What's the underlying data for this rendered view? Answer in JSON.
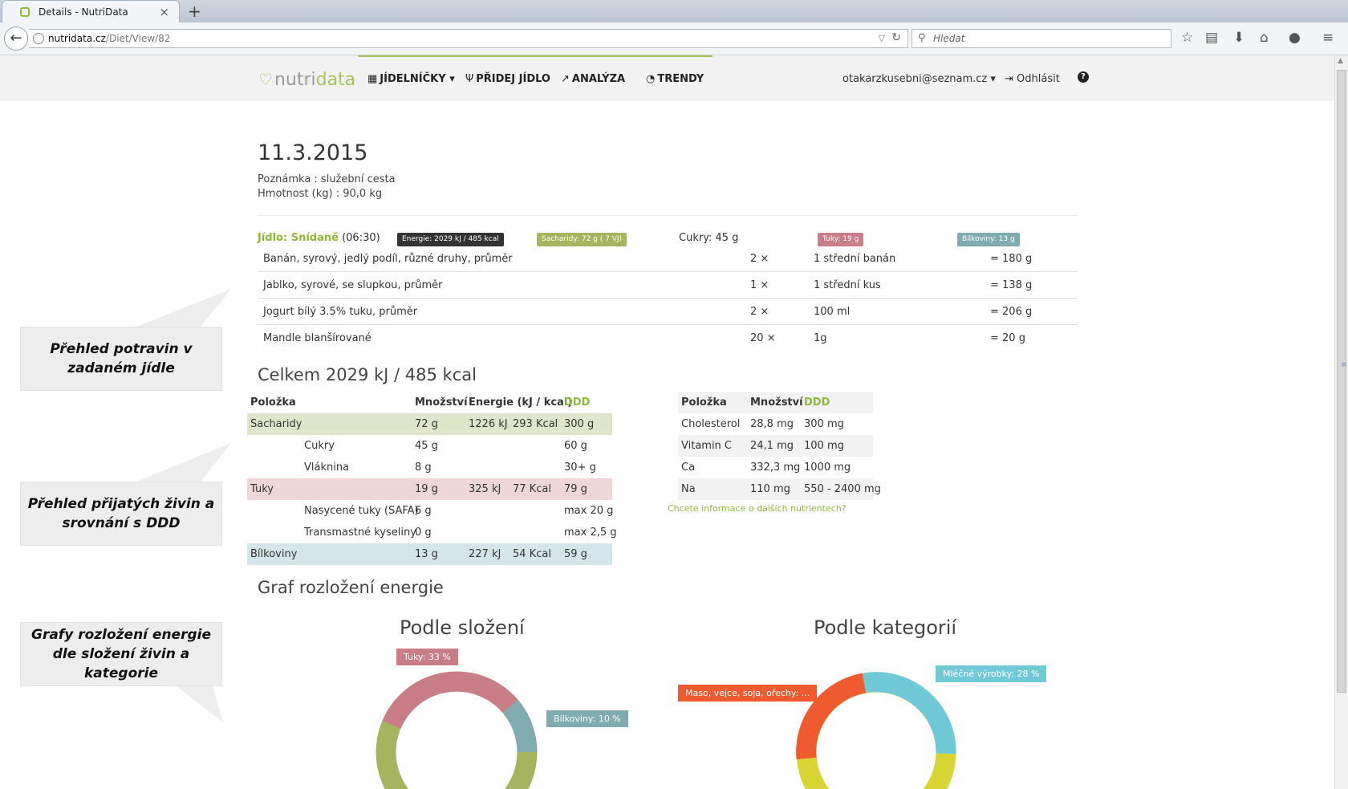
{
  "browser": {
    "tab_title": "Details - NutriData",
    "new_tab": "+",
    "url_host": "nutridata.cz",
    "url_path": "/Diet/View/82",
    "search_placeholder": "Hledat"
  },
  "header": {
    "logo_a": "nutri",
    "logo_b": "data",
    "nav": [
      {
        "label": "JÍDELNÍČKY",
        "icon": "calendar-icon"
      },
      {
        "label": "PŘIDEJ JÍDLO",
        "icon": "cutlery-icon"
      },
      {
        "label": "ANALÝZA",
        "icon": "line-chart-icon"
      },
      {
        "label": "TRENDY",
        "icon": "dashboard-icon"
      }
    ],
    "user_email": "otakarzkusebni@seznam.cz",
    "logout": "Odhlásit"
  },
  "diet": {
    "date": "11.3.2015",
    "note": "Poznámka : služební cesta",
    "weight": "Hmotnost (kg) : 90,0 kg"
  },
  "meal": {
    "label": "Jídlo: Snídaně",
    "time": "(06:30)",
    "badges": {
      "energy": "Energie: 2029 kJ / 485 kcal",
      "carbs": "Sacharidy: 72 g ( 7 VJ)",
      "sugar": "Cukry: 45 g",
      "fat": "Tuky: 19 g",
      "protein": "Bílkoviny: 13 g"
    },
    "foods": [
      {
        "name": "Banán, syrový, jedlý podíl, různé druhy, průměr",
        "count": "2 ×",
        "unit": "1 střední banán",
        "total": "= 180 g"
      },
      {
        "name": "Jablko, syrové, se slupkou, průměr",
        "count": "1 ×",
        "unit": "1 střední kus",
        "total": "= 138 g"
      },
      {
        "name": "Jogurt bílý 3.5% tuku, průměr",
        "count": "2 ×",
        "unit": "100 ml",
        "total": "= 206 g"
      },
      {
        "name": "Mandle blanšírované",
        "count": "20 ×",
        "unit": "1g",
        "total": "= 20 g"
      }
    ]
  },
  "summary": {
    "title": "Celkem 2029 kJ / 485 kcal",
    "headers": {
      "item": "Položka",
      "amount": "Množství",
      "energy": "Energie (kJ / kcal)",
      "ddd": "DDD"
    },
    "rows": [
      {
        "name": "Sacharidy",
        "amount": "72 g",
        "kj": "1226 kJ",
        "kcal": "293 Kcal",
        "ddd": "300 g"
      },
      {
        "name": "Cukry",
        "amount": "45 g",
        "kj": "",
        "kcal": "",
        "ddd": "60 g"
      },
      {
        "name": "Vláknina",
        "amount": "8 g",
        "kj": "",
        "kcal": "",
        "ddd": "30+ g"
      },
      {
        "name": "Tuky",
        "amount": "19 g",
        "kj": "325 kJ",
        "kcal": "77 Kcal",
        "ddd": "79 g"
      },
      {
        "name": "Nasycené tuky (SAFA)",
        "amount": "6 g",
        "kj": "",
        "kcal": "",
        "ddd": "max 20 g"
      },
      {
        "name": "Transmastné kyseliny",
        "amount": "0 g",
        "kj": "",
        "kcal": "",
        "ddd": "max 2,5 g"
      },
      {
        "name": "Bílkoviny",
        "amount": "13 g",
        "kj": "227 kJ",
        "kcal": "54 Kcal",
        "ddd": "59 g"
      }
    ],
    "micro_headers": {
      "item": "Položka",
      "amount": "Množství",
      "ddd": "DDD"
    },
    "micro": [
      {
        "name": "Cholesterol",
        "amount": "28,8 mg",
        "ddd": "300 mg"
      },
      {
        "name": "Vitamin C",
        "amount": "24,1 mg",
        "ddd": "100 mg"
      },
      {
        "name": "Ca",
        "amount": "332,3 mg",
        "ddd": "1000 mg"
      },
      {
        "name": "Na",
        "amount": "110 mg",
        "ddd": "550 - 2400 mg"
      }
    ],
    "more_link": "Chcete informace o dalších nutrientech?"
  },
  "graphs": {
    "title": "Graf rozložení energie",
    "composition": {
      "title": "Podle složení",
      "label_fat": "Tuky: 33 %",
      "label_protein": "Bílkoviny: 10 %"
    },
    "category": {
      "title": "Podle kategorií",
      "label_meat": "Maso, vejce, soja, ořechy: ...",
      "label_dairy": "Mléčné výrobky: 28 %"
    }
  },
  "callouts": [
    "Přehled potravin v zadaném jídle",
    "Přehled přijatých živin a srovnání s DDD",
    "Grafy rozložení energie dle složení živin a kategorie"
  ],
  "colors": {
    "accent": "#8fb83a",
    "carbs": "#a6b45f",
    "fat": "#c97d86",
    "protein": "#7fabb1",
    "meat": "#ef5b2f",
    "dairy": "#70c9d6",
    "yellow": "#d7d434"
  }
}
